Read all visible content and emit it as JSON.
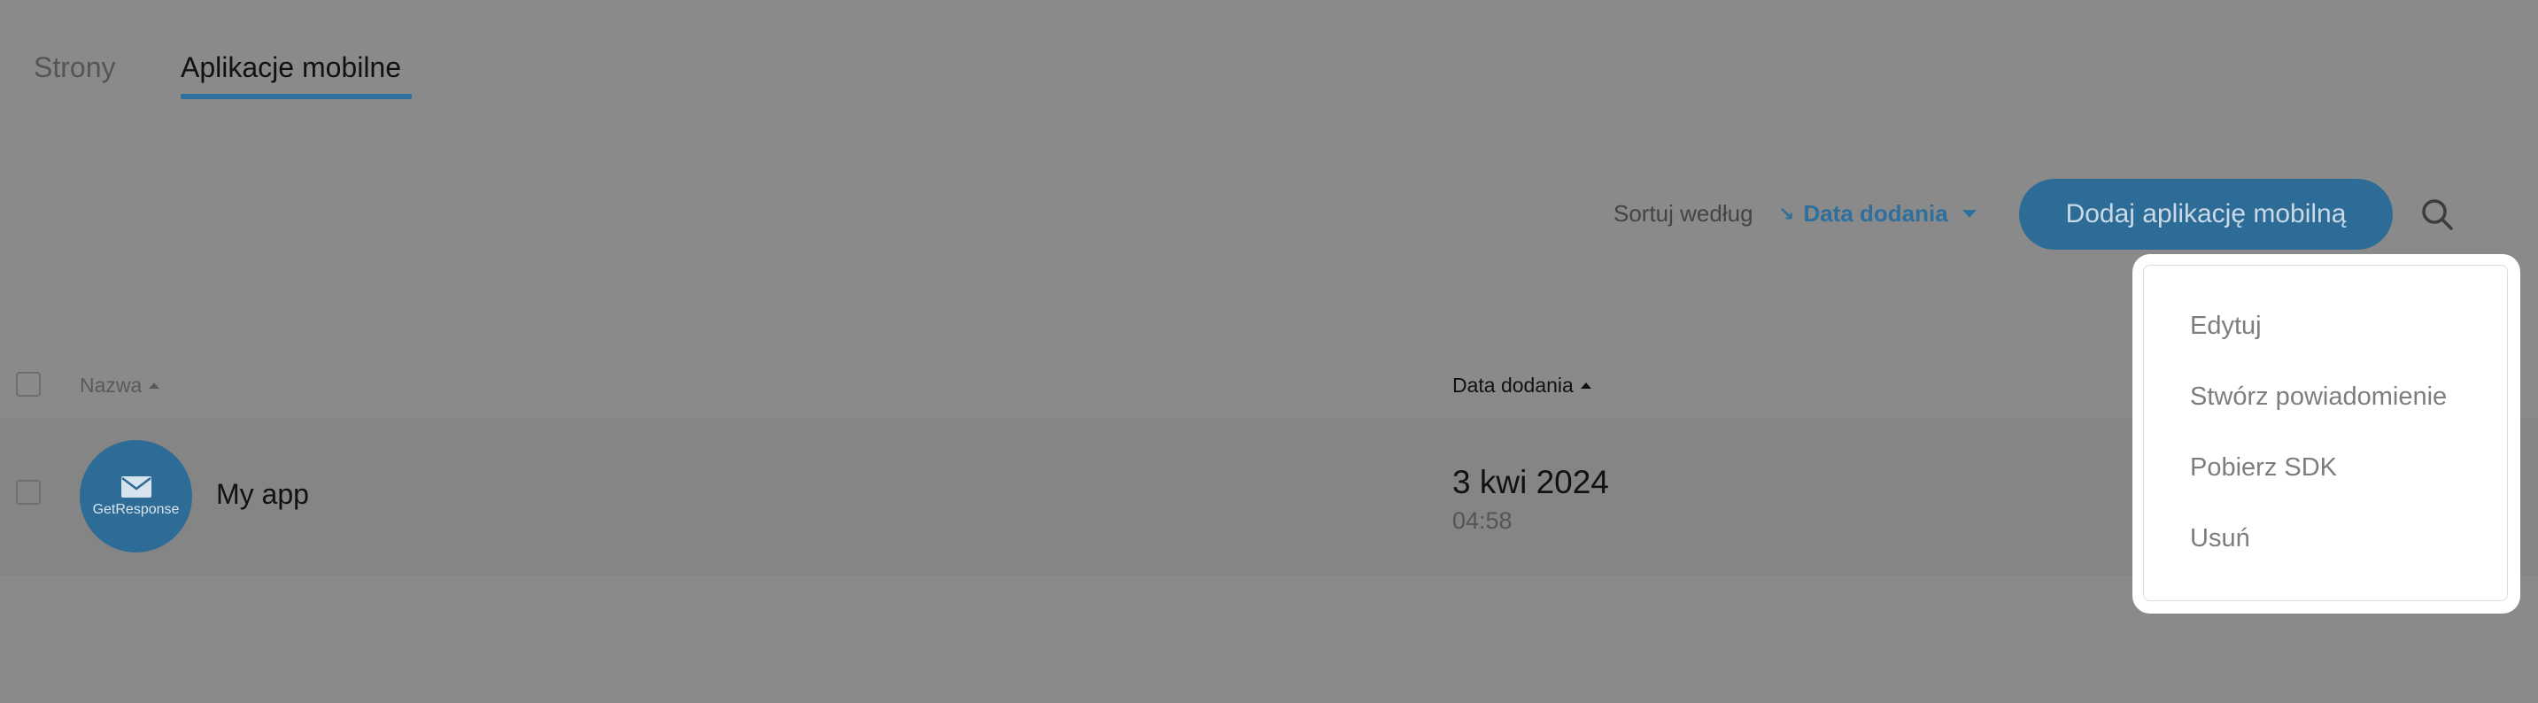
{
  "tabs": [
    {
      "label": "Strony"
    },
    {
      "label": "Aplikacje mobilne",
      "active": true
    }
  ],
  "toolbar": {
    "sort_label": "Sortuj według",
    "sort_value": "Data dodania",
    "add_button_label": "Dodaj aplikację mobilną",
    "search_icon": "search-icon"
  },
  "table": {
    "columns": [
      "Nazwa",
      "Data dodania"
    ],
    "rows": [
      {
        "avatar_brand": "GetResponse",
        "name": "My app",
        "date": "3 kwi 2024",
        "time": "04:58"
      }
    ]
  },
  "context_menu": {
    "items": [
      "Edytuj",
      "Stwórz powiadomienie",
      "Pobierz SDK",
      "Usuń"
    ]
  },
  "colors": {
    "accent": "#2f6f9d",
    "overlay_background": "#8a8a8a",
    "menu_background": "#ffffff"
  }
}
